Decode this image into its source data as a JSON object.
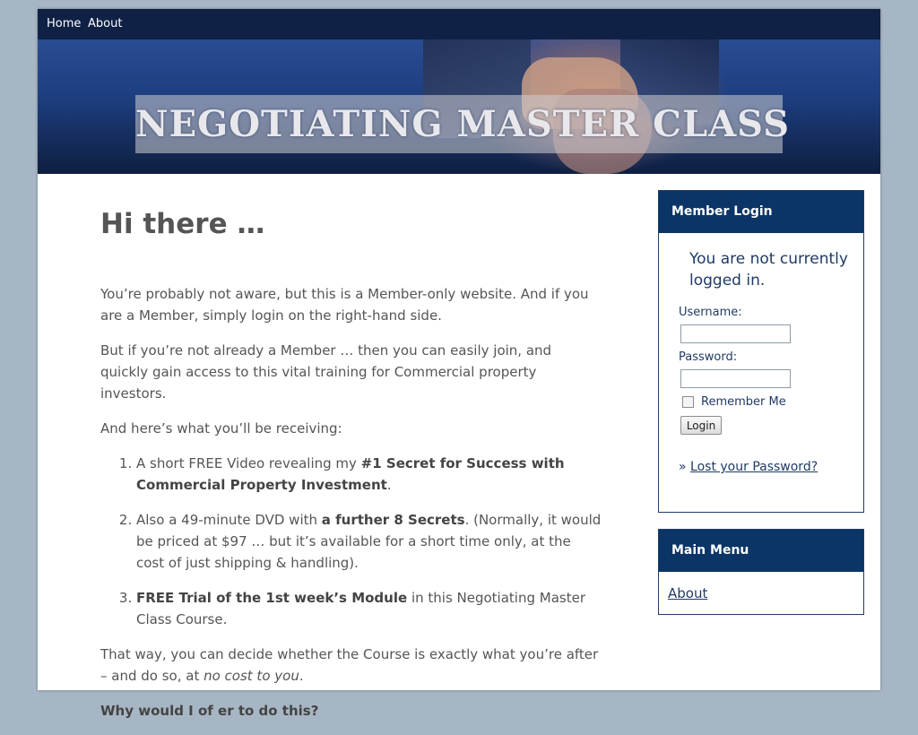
{
  "nav": {
    "home": "Home",
    "about": "About"
  },
  "banner": {
    "title": "NEGOTIATING MASTER CLASS"
  },
  "post": {
    "title": "Hi there …",
    "p1": "You’re probably not aware, but this is a Member-only website. And if you are a Member, simply login on the right-hand side.",
    "p2": "But if you’re not already a Member … then you can easily join, and quickly gain access to this vital training for Commercial property investors.",
    "p3": "And here’s what you’ll be receiving:",
    "items": [
      {
        "pre": "A short FREE Video revealing my ",
        "strong": "#1 Secret for Success with Commercial Property Investment",
        "post": "."
      },
      {
        "pre": "Also a 49-minute DVD with ",
        "strong": "a further 8 Secrets",
        "post": ". (Normally, it would be priced at $97 …  but it’s available for a short time only, at the cost of just shipping & handling)."
      },
      {
        "pre": "",
        "strong": "FREE Trial of the 1st week’s Module",
        "post": " in this Negotiating Master Class Course."
      }
    ],
    "p4_pre": "That way, you can decide whether the Course is exactly what you’re after – and do so, at ",
    "p4_em": "no cost to you",
    "p4_post": ".",
    "p5": "Why would I of er to do this?"
  },
  "login_widget": {
    "title": "Member Login",
    "status": "You are not currently logged in.",
    "username_label": "Username:",
    "username_value": "",
    "password_label": "Password:",
    "password_value": "",
    "remember_label": "Remember Me",
    "remember_checked": false,
    "login_button": "Login",
    "bullet": "»",
    "lost_password": "Lost your Password?"
  },
  "menu_widget": {
    "title": "Main Menu",
    "items": [
      "About"
    ]
  },
  "colors": {
    "page_background": "#a7b6c4",
    "nav_bar": "#0f2145",
    "widget_header": "#0a3566",
    "link": "#1f3a66",
    "body_text": "#555555"
  }
}
